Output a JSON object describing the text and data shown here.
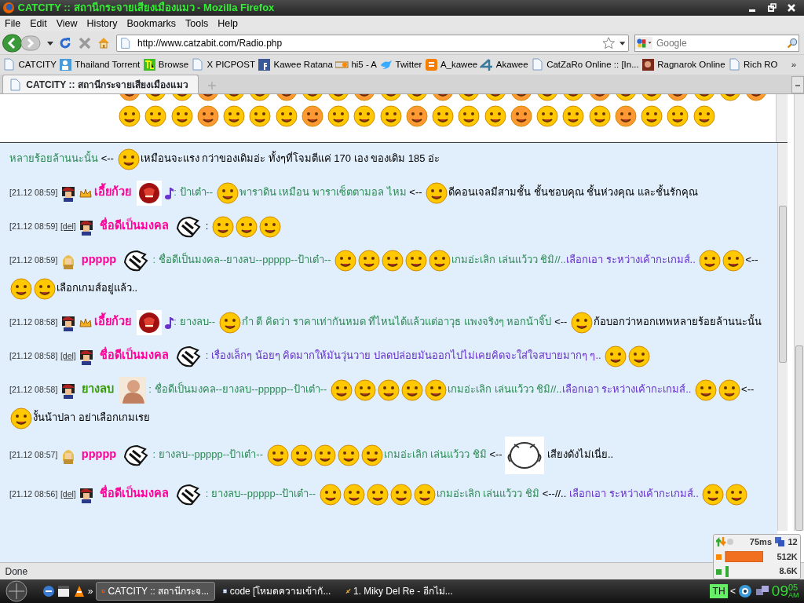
{
  "window": {
    "title": "CATCITY :: สถานีกระจายเสียงเมืองแมว - Mozilla Firefox"
  },
  "menu": [
    "File",
    "Edit",
    "View",
    "History",
    "Bookmarks",
    "Tools",
    "Help"
  ],
  "address": {
    "url": "http://www.catzabit.com/Radio.php"
  },
  "search": {
    "placeholder": "Google"
  },
  "bookmarks": [
    {
      "label": "CATCITY",
      "kind": "page"
    },
    {
      "label": "Thailand Torrent",
      "kind": "person"
    },
    {
      "label": "Browse",
      "kind": "tl"
    },
    {
      "label": "X PICPOST",
      "kind": "page"
    },
    {
      "label": "Kawee Ratana",
      "kind": "facebook"
    },
    {
      "label": "hi5 - A",
      "kind": "hi5"
    },
    {
      "label": "Twitter",
      "kind": "bird"
    },
    {
      "label": "A_kawee",
      "kind": "blogger"
    },
    {
      "label": "Akawee",
      "kind": "four"
    },
    {
      "label": "CatZaRo Online :: [In...",
      "kind": "page"
    },
    {
      "label": "Ragnarok Online",
      "kind": "game"
    },
    {
      "label": "Rich RO",
      "kind": "page"
    }
  ],
  "bookmarks_more": "»",
  "tabs": [
    {
      "label": "CATCITY :: สถานีกระจายเสียงเมืองแมว",
      "selected": true
    }
  ],
  "messages": [
    {
      "parts": [
        {
          "kind": "text",
          "text": "หลายร้อยล้านนะนั้น",
          "color": "#2e8b57"
        },
        {
          "kind": "arrow",
          "text": "<--"
        },
        {
          "kind": "smiley"
        },
        {
          "kind": "text",
          "text": "เหมือนจะแรง กว่าของเดิมอ่ะ ทั้งๆที่โจมตีแค่ 170 เอง ของเดิม 185 อ่ะ",
          "color": "#000000"
        }
      ]
    },
    {
      "parts": [
        {
          "kind": "time",
          "text": "[21.12 08:59]"
        },
        {
          "kind": "avatar"
        },
        {
          "kind": "crown"
        },
        {
          "kind": "name",
          "text": "เอี้ยก้วย",
          "color": "#ff0099"
        },
        {
          "kind": "emblem"
        },
        {
          "kind": "note"
        },
        {
          "kind": "text",
          "text": ": ป้าเต๋า--",
          "color": "#2e8b57"
        },
        {
          "kind": "smiley"
        },
        {
          "kind": "text",
          "text": "พาราดิน เหมือน พาราเซ็ตตามอล ไหม",
          "color": "#2e8b57"
        },
        {
          "kind": "arrow",
          "text": "<--"
        },
        {
          "kind": "smiley"
        },
        {
          "kind": "text",
          "text": "ดีคอนเจลมีสามชั้น ชั้นชอบคุณ ชั้นห่วงคุณ และชั้นรักคุณ",
          "color": "#000000"
        }
      ]
    },
    {
      "parts": [
        {
          "kind": "time",
          "text": "[21.12 08:59]"
        },
        {
          "kind": "del",
          "text": "[del]"
        },
        {
          "kind": "avatar"
        },
        {
          "kind": "name",
          "text": "ชื่อดีเป็นมงคล",
          "color": "#ff0099"
        },
        {
          "kind": "catbadge"
        },
        {
          "kind": "colon",
          "text": ":"
        },
        {
          "kind": "smiley"
        },
        {
          "kind": "smiley"
        },
        {
          "kind": "smiley"
        }
      ]
    },
    {
      "parts": [
        {
          "kind": "time",
          "text": "[21.12 08:59]"
        },
        {
          "kind": "avatar"
        },
        {
          "kind": "name",
          "text": "ppppp",
          "color": "#ff0099"
        },
        {
          "kind": "catbadge"
        },
        {
          "kind": "text",
          "text": ": ชื่อดีเป็นมงคล--ยางลบ--ppppp--ป้าเต๋า--",
          "color": "#2e8b57"
        },
        {
          "kind": "smiley"
        },
        {
          "kind": "smiley"
        },
        {
          "kind": "smiley"
        },
        {
          "kind": "smiley"
        },
        {
          "kind": "smiley"
        },
        {
          "kind": "text",
          "text": "เกมอ่ะเลิก เล่นแว้วว ชิมิ//..",
          "color": "#2e8b57"
        },
        {
          "kind": "text",
          "text": "เลือกเอา ระหว่างเค้ากะ",
          "color": "#6633cc"
        },
        {
          "kind": "text",
          "text": "เกมส์..",
          "color": "#6633cc"
        },
        {
          "kind": "smiley"
        },
        {
          "kind": "smiley"
        },
        {
          "kind": "arrow",
          "text": "<--"
        },
        {
          "kind": "smiley"
        },
        {
          "kind": "smiley"
        },
        {
          "kind": "text",
          "text": "เลือกเกมส์อยู่แล้ว..",
          "color": "#000000"
        }
      ]
    },
    {
      "parts": [
        {
          "kind": "time",
          "text": "[21.12 08:58]"
        },
        {
          "kind": "avatar"
        },
        {
          "kind": "crown"
        },
        {
          "kind": "name",
          "text": "เอี้ยก้วย",
          "color": "#ff0099"
        },
        {
          "kind": "emblem"
        },
        {
          "kind": "note"
        },
        {
          "kind": "text",
          "text": ": ยางลบ--",
          "color": "#2e8b57"
        },
        {
          "kind": "smiley"
        },
        {
          "kind": "text",
          "text": "กำ ตี  คิดว่า ราคาเท่ากันหมด ที่ไหนได้แล้วแต่อาวุธ แพงจริงๆ หอกน้าจิ๊ป",
          "color": "#2e8b57"
        },
        {
          "kind": "arrow",
          "text": "<--"
        },
        {
          "kind": "smiley"
        },
        {
          "kind": "text",
          "text": "ก้อบอกว่าหอกเทพ",
          "color": "#000000"
        },
        {
          "kind": "text",
          "text": "หลายร้อยล้านนะนั้น",
          "color": "#000000"
        }
      ]
    },
    {
      "parts": [
        {
          "kind": "time",
          "text": "[21.12 08:58]"
        },
        {
          "kind": "del",
          "text": "[del]"
        },
        {
          "kind": "avatar"
        },
        {
          "kind": "name",
          "text": "ชื่อดีเป็นมงคล",
          "color": "#ff0099"
        },
        {
          "kind": "catbadge"
        },
        {
          "kind": "text",
          "text": ": เรื่องเล็กๆ น้อยๆ คิดมากให้มันวุ่นวาย  ปลดปล่อยมันออกไปไม่เคยคิดจะใส่ใจสบายมากๆ ๆ..",
          "color": "#6633cc"
        },
        {
          "kind": "smiley"
        },
        {
          "kind": "smiley"
        }
      ]
    },
    {
      "parts": [
        {
          "kind": "time",
          "text": "[21.12 08:58]"
        },
        {
          "kind": "avatar"
        },
        {
          "kind": "name",
          "text": "ยางลบ",
          "color": "#339900"
        },
        {
          "kind": "figure"
        },
        {
          "kind": "text",
          "text": ": ชื่อดีเป็นมงคล--ยางลบ--ppppp--ป้าเต๋า--",
          "color": "#2e8b57"
        },
        {
          "kind": "smiley"
        },
        {
          "kind": "smiley"
        },
        {
          "kind": "smiley"
        },
        {
          "kind": "smiley"
        },
        {
          "kind": "smiley"
        },
        {
          "kind": "text",
          "text": "เกมอ่ะเลิก เล่นแว้วว ชิมิ//..",
          "color": "#2e8b57"
        },
        {
          "kind": "text",
          "text": "เลือกเอา ระหว่างเค้ากะ",
          "color": "#6633cc"
        },
        {
          "kind": "text",
          "text": "เกมส์..",
          "color": "#6633cc"
        },
        {
          "kind": "smiley"
        },
        {
          "kind": "smiley"
        },
        {
          "kind": "arrow",
          "text": "<--"
        },
        {
          "kind": "smiley"
        },
        {
          "kind": "text",
          "text": "งั้นน้าปลา อย่าเลือกเกมเรย",
          "color": "#000000"
        }
      ]
    },
    {
      "parts": [
        {
          "kind": "time",
          "text": "[21.12 08:57]"
        },
        {
          "kind": "avatar"
        },
        {
          "kind": "name",
          "text": "ppppp",
          "color": "#ff0099"
        },
        {
          "kind": "catbadge"
        },
        {
          "kind": "text",
          "text": ": ยางลบ--ppppp--ป้าเต๋า--",
          "color": "#2e8b57"
        },
        {
          "kind": "smiley"
        },
        {
          "kind": "smiley"
        },
        {
          "kind": "smiley"
        },
        {
          "kind": "smiley"
        },
        {
          "kind": "smiley"
        },
        {
          "kind": "text",
          "text": "เกมอ่ะเลิก เล่นแว้วว ชิมิ",
          "color": "#2e8b57"
        },
        {
          "kind": "arrow",
          "text": "<--"
        },
        {
          "kind": "sticker"
        },
        {
          "kind": "text",
          "text": "เสียงดังไม่เนี่ย..",
          "color": "#000000"
        }
      ]
    },
    {
      "parts": [
        {
          "kind": "time",
          "text": "[21.12 08:56]"
        },
        {
          "kind": "del",
          "text": "[del]"
        },
        {
          "kind": "avatar"
        },
        {
          "kind": "name",
          "text": "ชื่อดีเป็นมงคล",
          "color": "#ff0099"
        },
        {
          "kind": "catbadge"
        },
        {
          "kind": "text",
          "text": ": ยางลบ--ppppp--ป้าเต๋า--",
          "color": "#2e8b57"
        },
        {
          "kind": "smiley"
        },
        {
          "kind": "smiley"
        },
        {
          "kind": "smiley"
        },
        {
          "kind": "smiley"
        },
        {
          "kind": "smiley"
        },
        {
          "kind": "text",
          "text": "เกมอ่ะเลิก เล่นแว้วว ชิมิ",
          "color": "#2e8b57"
        },
        {
          "kind": "arrow",
          "text": "<--//.."
        },
        {
          "kind": "text",
          "text": "เลือกเอา ระหว่างเค้ากะ",
          "color": "#6633cc"
        },
        {
          "kind": "text",
          "text": "เกมส์..",
          "color": "#6633cc"
        },
        {
          "kind": "smiley"
        },
        {
          "kind": "smiley"
        }
      ]
    }
  ],
  "status_bar": {
    "text": "Done"
  },
  "net_monitor": {
    "ping": "75ms",
    "count": "12",
    "download": "512K",
    "upload": "8.6K"
  },
  "taskbar": {
    "more": "»",
    "tasks": [
      {
        "label": "CATCITY :: สถานีกระจ...",
        "selected": true,
        "kind": "firefox"
      },
      {
        "label": "code [โหมดความเข้ากั...",
        "selected": false,
        "kind": "word"
      },
      {
        "label": "1. Miky Del Re - อีกไม่...",
        "selected": false,
        "kind": "player"
      }
    ],
    "language": "TH",
    "tray_arrow": "<",
    "clock_hour": "09",
    "clock_minute": "05",
    "clock_ampm": "AM"
  }
}
